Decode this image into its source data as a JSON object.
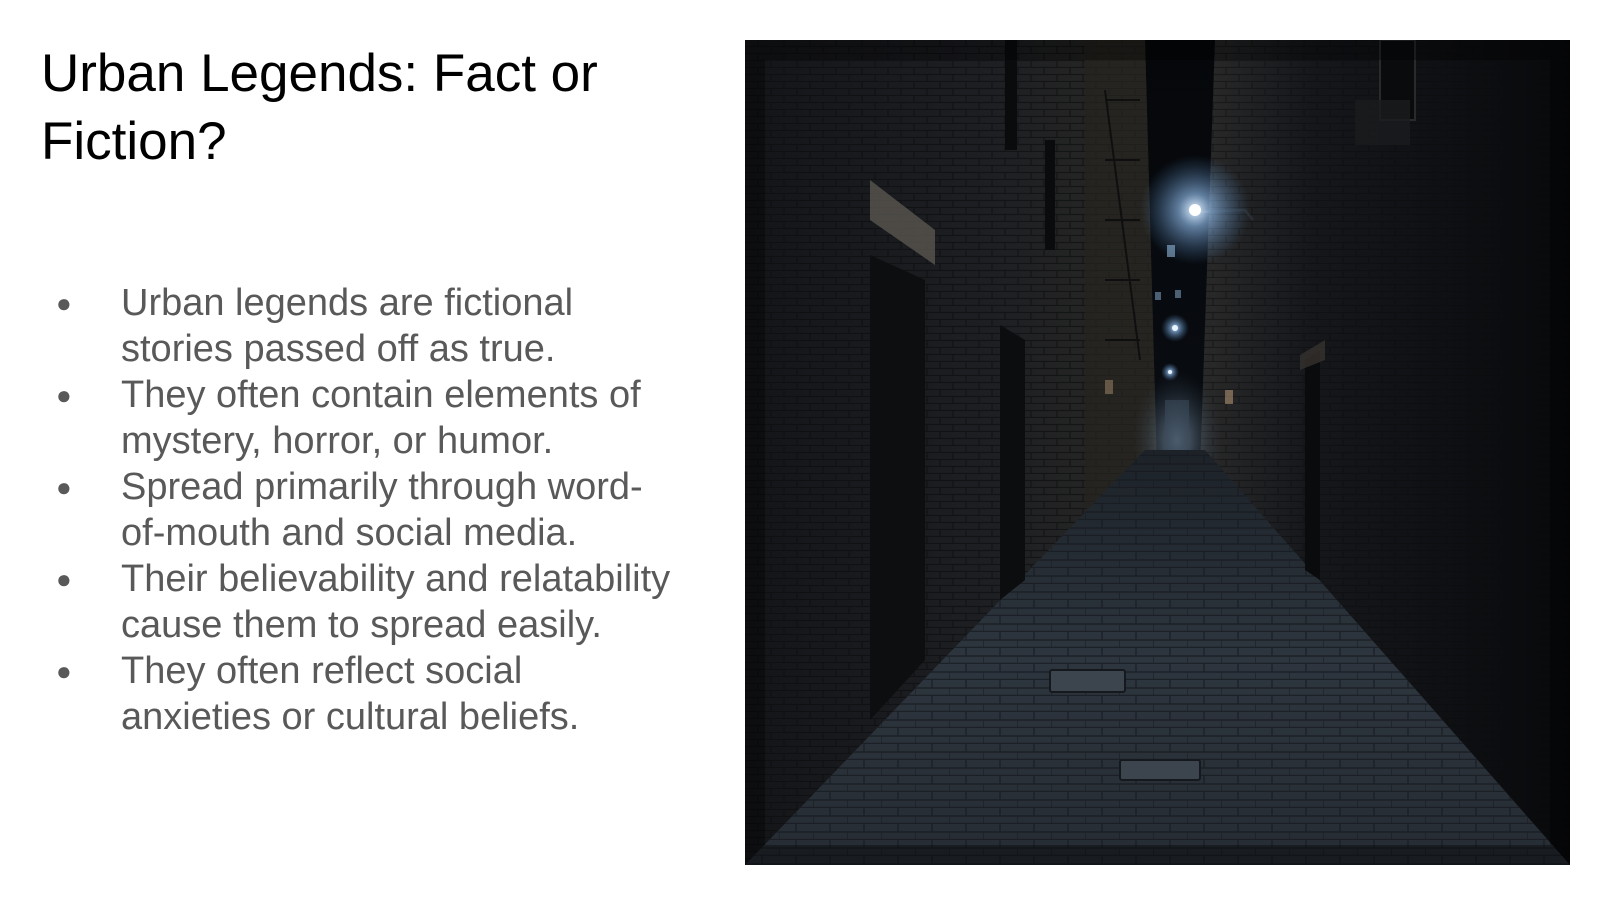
{
  "slide": {
    "title": "Urban Legends: Fact or Fiction?",
    "bullets": [
      "Urban legends are fictional stories passed off as true.",
      "They often contain elements of mystery, horror, or humor.",
      "Spread primarily through word-of-mouth and social media.",
      "Their believability and relatability cause them to spread easily.",
      "They often reflect social anxieties or cultural beliefs."
    ],
    "bullet_glyph": "●",
    "photo": {
      "subject": "dark-alley-night-photo",
      "colors": {
        "sky": "#05070a",
        "wall_left": "#1a1c20",
        "wall_right": "#101216",
        "pavement": "#2c333b",
        "lamp_glow": "#bfe0ff"
      }
    }
  }
}
